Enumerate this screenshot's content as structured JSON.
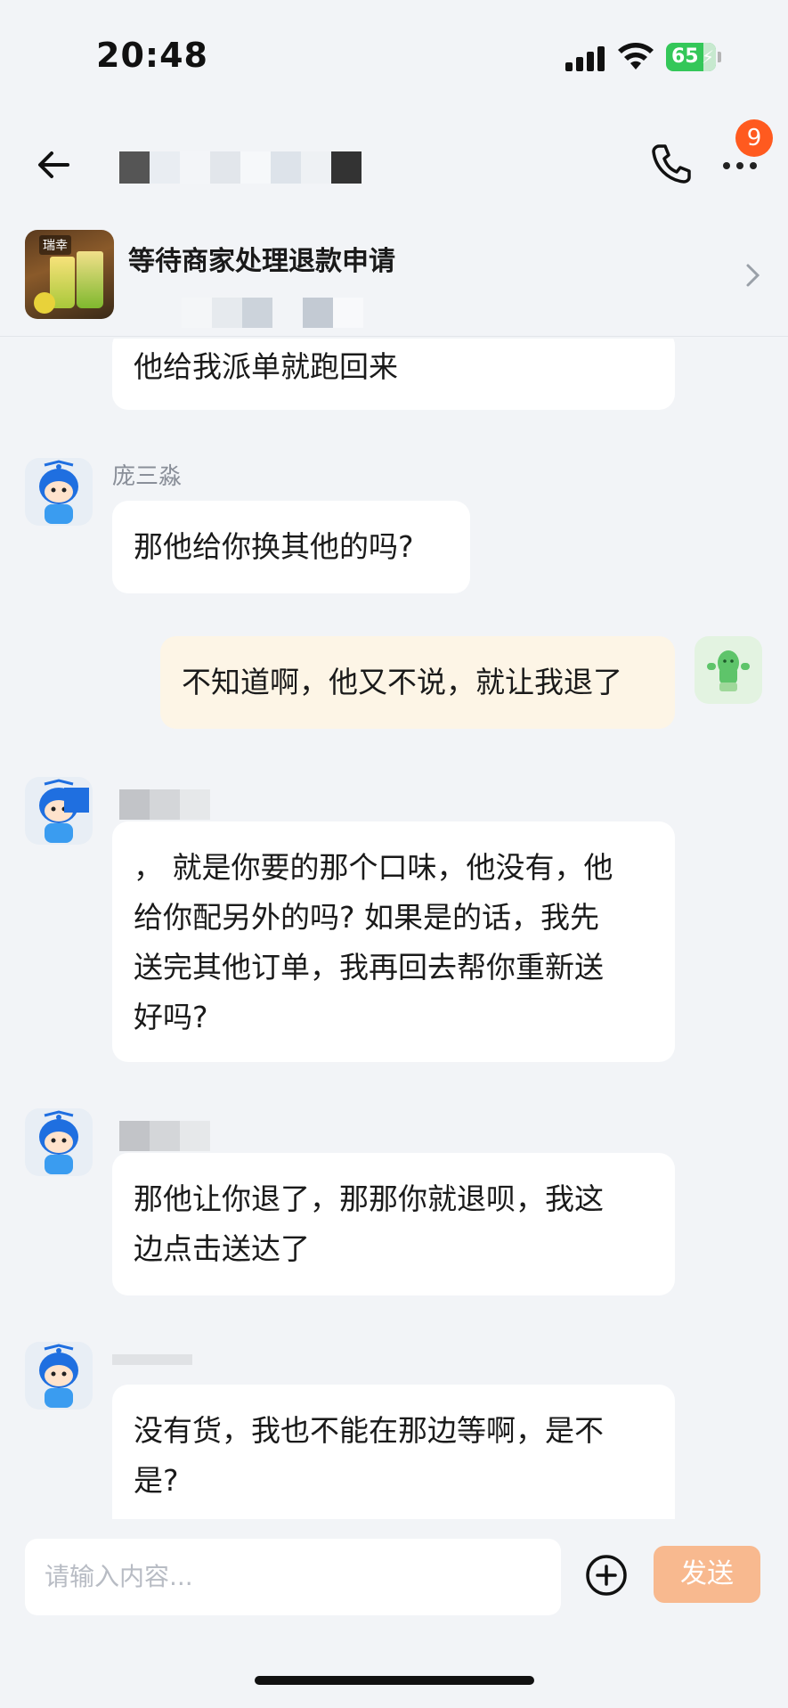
{
  "status_bar": {
    "time": "20:48",
    "battery": "65"
  },
  "header": {
    "badge_count": "9"
  },
  "order": {
    "title": "等待商家处理退款申请",
    "thumb_label": "瑞幸"
  },
  "messages": [
    {
      "side": "left",
      "text": "他给我派单就跑回来"
    },
    {
      "side": "left",
      "sender": "庞三淼",
      "text": "那他给你换其他的吗?"
    },
    {
      "side": "right",
      "text": "不知道啊，他又不说，就让我退了"
    },
    {
      "side": "left",
      "lines": [
        "，  就是你要的那个口味，他没有，他",
        "给你配另外的吗? 如果是的话，我先",
        "送完其他订单，我再回去帮你重新送",
        "好吗?"
      ]
    },
    {
      "side": "left",
      "lines": [
        "那他让你退了，那那你就退呗，我这",
        "边点击送达了"
      ]
    },
    {
      "side": "left",
      "lines": [
        "没有货，我也不能在那边等啊，是不",
        "是?"
      ]
    }
  ],
  "input": {
    "placeholder": "请输入内容...",
    "send_label": "发送"
  }
}
